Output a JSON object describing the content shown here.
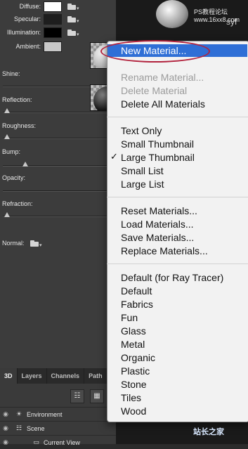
{
  "header": {
    "brand_text": "PS教程论坛",
    "brand_url": "www.16xx8.com",
    "side_text": "syf"
  },
  "properties": [
    {
      "label": "Diffuse:",
      "color": "#ffffff",
      "has_folder": true
    },
    {
      "label": "Specular:",
      "color": "#1e1e1e",
      "has_folder": true
    },
    {
      "label": "Illumination:",
      "color": "#000000",
      "has_folder": true
    },
    {
      "label": "Ambient:",
      "color": "#c8c8c8",
      "has_folder": false
    }
  ],
  "sliders": [
    {
      "label": "Shine:",
      "value": 0.5
    },
    {
      "label": "Reflection:",
      "value": 0.02
    },
    {
      "label": "Roughness:",
      "value": 0.02
    },
    {
      "label": "Bump:",
      "value": 0.2
    },
    {
      "label": "Opacity:",
      "value": 0.98
    },
    {
      "label": "Refraction:",
      "value": 0.02
    }
  ],
  "normal": {
    "label": "Normal:"
  },
  "bottom_panel": {
    "tabs": [
      "3D",
      "Layers",
      "Channels",
      "Path"
    ],
    "active_tab": "3D",
    "scene_items": [
      {
        "label": "Environment",
        "icon": "sun-icon"
      },
      {
        "label": "Scene",
        "icon": "scene-icon"
      },
      {
        "label": "Current View",
        "icon": "camera-icon"
      }
    ]
  },
  "menu": {
    "items_group1": [
      "New Material...",
      "Rename Material...",
      "Delete Material",
      "Delete All Materials"
    ],
    "disabled_group1": [
      false,
      true,
      true,
      false
    ],
    "items_group2": [
      "Text Only",
      "Small Thumbnail",
      "Large Thumbnail",
      "Small List",
      "Large List"
    ],
    "checked_item": "Large Thumbnail",
    "items_group3": [
      "Reset Materials...",
      "Load Materials...",
      "Save Materials...",
      "Replace Materials..."
    ],
    "items_group4": [
      "Default (for Ray Tracer)",
      "Default",
      "Fabrics",
      "Fun",
      "Glass",
      "Metal",
      "Organic",
      "Plastic",
      "Stone",
      "Tiles",
      "Wood"
    ]
  },
  "watermark": "站长之家"
}
